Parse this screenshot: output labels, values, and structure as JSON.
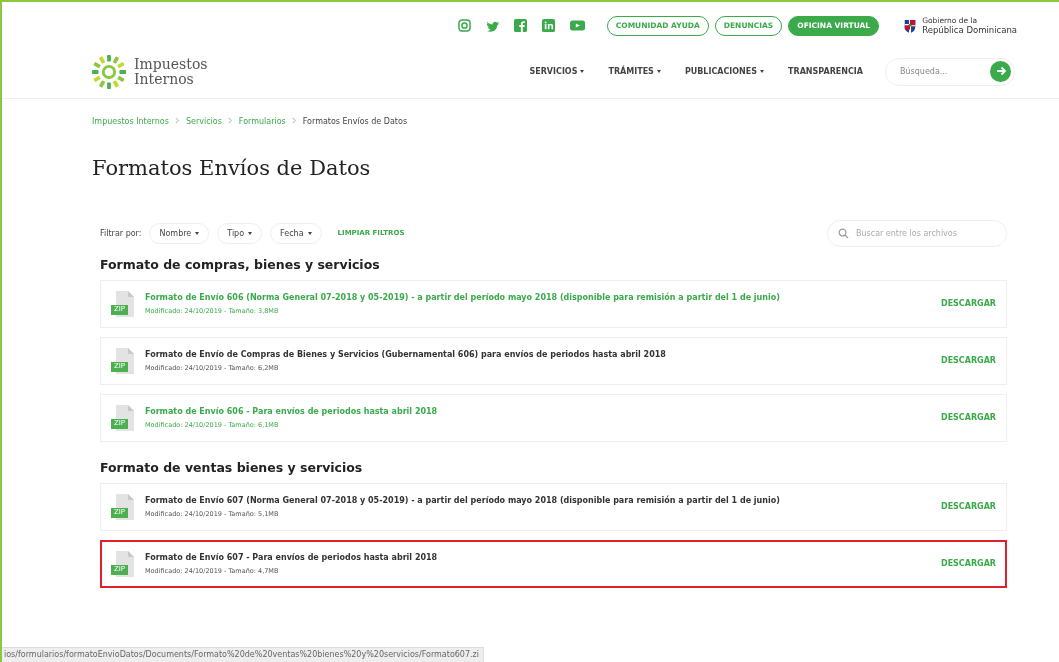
{
  "top_bar": {
    "buttons": [
      {
        "label": "COMUNIDAD AYUDA",
        "filled": false
      },
      {
        "label": "DENUNCIAS",
        "filled": false
      },
      {
        "label": "OFICINA VIRTUAL",
        "filled": true
      }
    ],
    "government": {
      "line1": "Gobierno de la",
      "line2": "República Dominicana"
    }
  },
  "header": {
    "logo": {
      "line1": "Impuestos",
      "line2": "Internos"
    },
    "nav": [
      {
        "label": "SERVICIOS",
        "dropdown": true
      },
      {
        "label": "TRÁMITES",
        "dropdown": true
      },
      {
        "label": "PUBLICACIONES",
        "dropdown": true
      },
      {
        "label": "TRANSPARENCIA",
        "dropdown": false
      }
    ],
    "search": {
      "placeholder": "Búsqueda..."
    }
  },
  "breadcrumb": [
    {
      "label": "Impuestos Internos",
      "current": false
    },
    {
      "label": "Servicios",
      "current": false
    },
    {
      "label": "Formularios",
      "current": false
    },
    {
      "label": "Formatos Envíos de Datos",
      "current": true
    }
  ],
  "page_title": "Formatos Envíos de Datos",
  "filters": {
    "label": "Filtrar por:",
    "dropdowns": [
      "Nombre",
      "Tipo",
      "Fecha"
    ],
    "clear": "LIMPIAR FILTROS",
    "search": {
      "placeholder": "Buscar entre los archivos"
    }
  },
  "sections": [
    {
      "title": "Formato de compras, bienes y servicios",
      "files": [
        {
          "name": "Formato de Envío 606 (Norma General 07-2018 y 05-2019) - a partir del período mayo 2018 (disponible para remisión a partir del 1 de junio)",
          "meta": "Modificado: 24/10/2019 - Tamaño: 3,8MB",
          "badge": "ZIP",
          "action": "DESCARGAR",
          "highlighted": true,
          "outlined": false
        },
        {
          "name": "Formato de Envío de Compras de Bienes y Servicios (Gubernamental 606) para envíos de periodos hasta abril 2018",
          "meta": "Modificado: 24/10/2019 - Tamaño: 6,2MB",
          "badge": "ZIP",
          "action": "DESCARGAR",
          "highlighted": false,
          "outlined": false
        },
        {
          "name": "Formato de Envío 606 - Para envíos de periodos hasta abril 2018",
          "meta": "Modificado: 24/10/2019 - Tamaño: 6,1MB",
          "badge": "ZIP",
          "action": "DESCARGAR",
          "highlighted": true,
          "outlined": false
        }
      ]
    },
    {
      "title": "Formato de ventas bienes y servicios",
      "files": [
        {
          "name": "Formato de Envío 607 (Norma General 07-2018 y 05-2019) - a partir del período mayo 2018 (disponible para remisión a partir del 1 de junio)",
          "meta": "Modificado: 24/10/2019 - Tamaño: 5,1MB",
          "badge": "ZIP",
          "action": "DESCARGAR",
          "highlighted": false,
          "outlined": false
        },
        {
          "name": "Formato de Envío 607 - Para envíos de periodos hasta abril 2018",
          "meta": "Modificado: 24/10/2019 - Tamaño: 4,7MB",
          "badge": "ZIP",
          "action": "DESCARGAR",
          "highlighted": false,
          "outlined": true
        }
      ]
    }
  ],
  "status_bar": {
    "url": "ios/formularios/formatoEnvioDatos/Documents/Formato%20de%20ventas%20bienes%20y%20servicios/Formato607.zi"
  }
}
